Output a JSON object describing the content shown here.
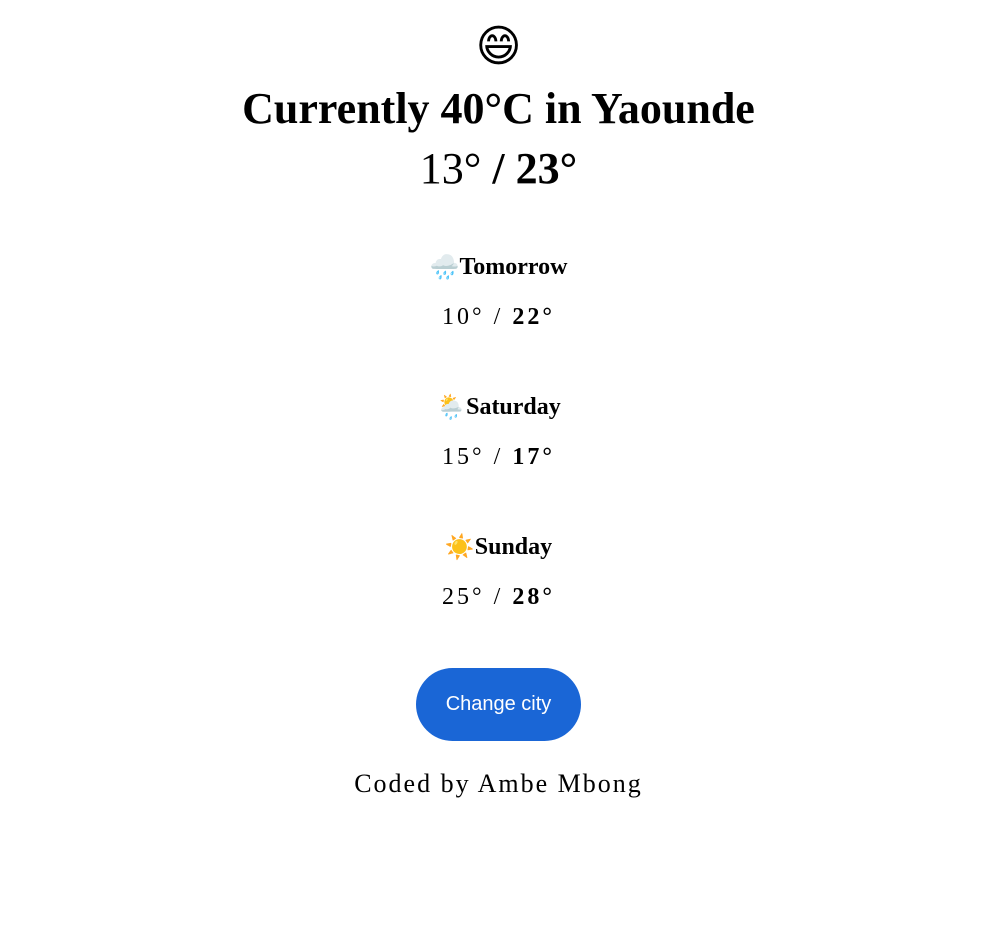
{
  "current": {
    "mood_emoji": "😄",
    "title": "Currently 40°C in Yaounde",
    "low": "13°",
    "separator": "/",
    "high": "23°"
  },
  "forecast": [
    {
      "icon": "🌧️",
      "icon_name": "rain-cloud-icon",
      "day": "Tomorrow",
      "low": "10°",
      "separator": "/",
      "high": "22°"
    },
    {
      "icon": "🌦️",
      "icon_name": "sun-behind-rain-cloud-icon",
      "day": "Saturday",
      "low": "15°",
      "separator": "/",
      "high": "17°"
    },
    {
      "icon": "☀️",
      "icon_name": "sun-icon",
      "day": "Sunday",
      "low": "25°",
      "separator": "/",
      "high": "28°"
    }
  ],
  "actions": {
    "change_city_label": "Change city"
  },
  "footer": {
    "credit": "Coded by Ambe Mbong"
  },
  "colors": {
    "button_bg": "#1a66d6",
    "button_text": "#ffffff",
    "text": "#000000",
    "background": "#ffffff"
  }
}
